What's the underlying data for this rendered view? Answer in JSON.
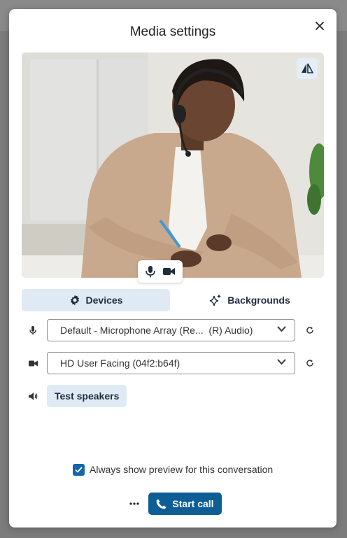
{
  "dialog": {
    "title": "Media settings"
  },
  "preview": {
    "mirror_icon": "mirror-icon",
    "controls": {
      "mic_icon": "microphone-icon",
      "camera_icon": "camera-icon"
    }
  },
  "tabs": [
    {
      "label": "Devices",
      "icon": "gear-icon",
      "active": true
    },
    {
      "label": "Backgrounds",
      "icon": "sparkle-icon",
      "active": false
    }
  ],
  "devices": {
    "microphone": {
      "icon": "microphone-icon",
      "value": "Default - Microphone Array (Re...  (R) Audio)"
    },
    "camera": {
      "icon": "camera-icon",
      "value": "HD User Facing (04f2:b64f)"
    },
    "speaker": {
      "icon": "speaker-icon",
      "button_label": "Test speakers"
    }
  },
  "footer": {
    "checkbox_label": "Always show preview for this conversation",
    "checkbox_checked": true,
    "more_label": "•••",
    "start_call_label": "Start call"
  },
  "colors": {
    "accent": "#0e5e96",
    "tab_active_bg": "#dfeaf5",
    "checkbox": "#1565a8"
  }
}
